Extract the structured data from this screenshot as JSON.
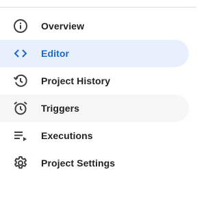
{
  "nav": {
    "items": [
      {
        "label": "Overview",
        "icon": "info-icon",
        "state": "default"
      },
      {
        "label": "Editor",
        "icon": "code-icon",
        "state": "active"
      },
      {
        "label": "Project History",
        "icon": "history-icon",
        "state": "default"
      },
      {
        "label": "Triggers",
        "icon": "alarm-icon",
        "state": "hover"
      },
      {
        "label": "Executions",
        "icon": "playlist-play-icon",
        "state": "default"
      },
      {
        "label": "Project Settings",
        "icon": "gear-icon",
        "state": "default"
      }
    ]
  },
  "colors": {
    "active_bg": "#e8f0fe",
    "active_text": "#1967d2",
    "hover_bg": "#f6f6f6",
    "text": "#202124",
    "icon": "#5f6368",
    "divider": "#dadce0"
  }
}
